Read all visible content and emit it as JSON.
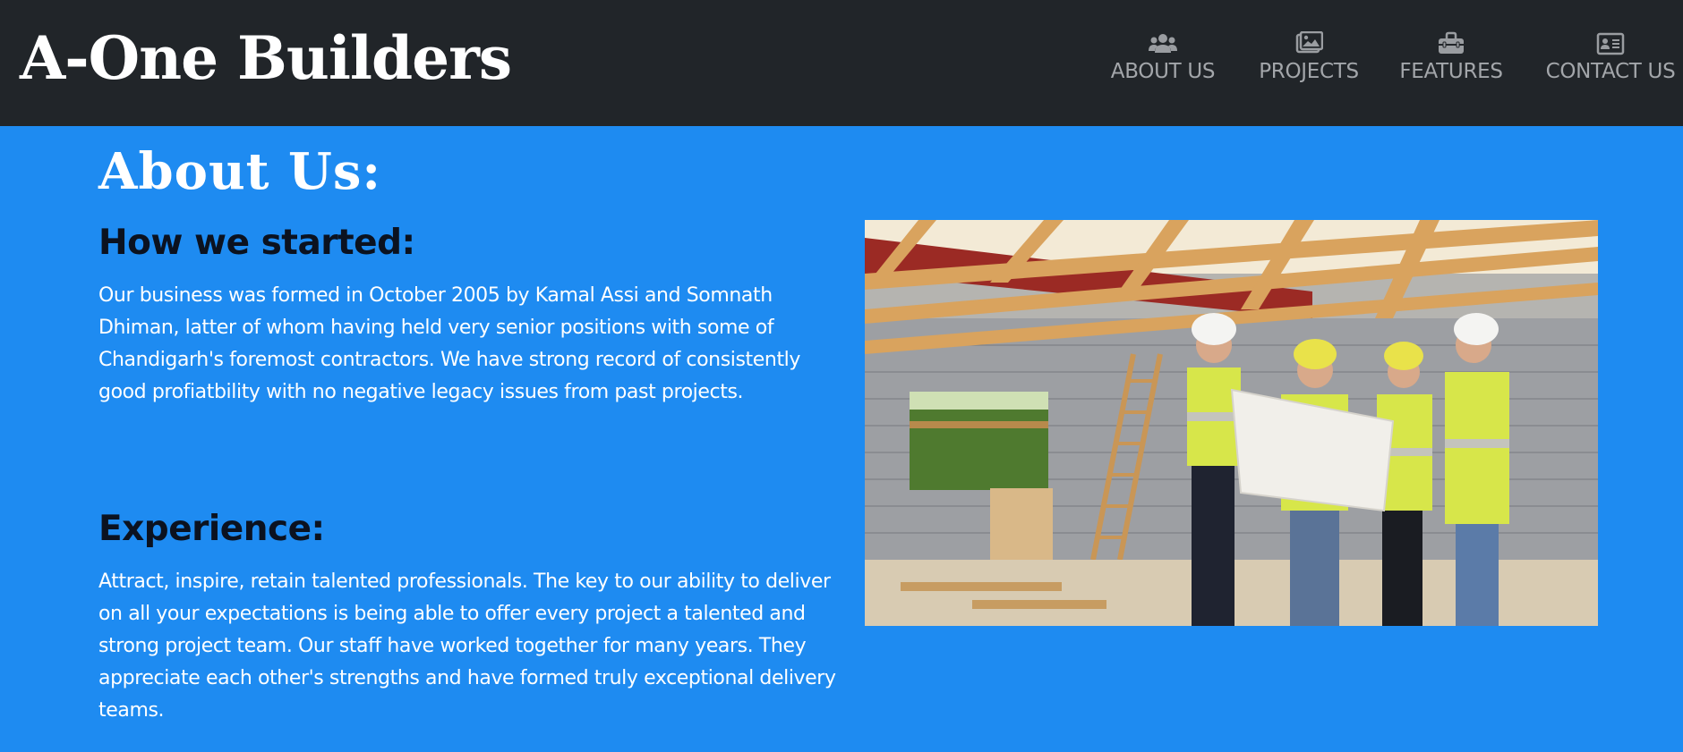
{
  "navbar": {
    "brand": "A-One Builders",
    "items": [
      {
        "label": "ABOUT US",
        "icon": "users-icon"
      },
      {
        "label": "PROJECTS",
        "icon": "images-icon"
      },
      {
        "label": "FEATURES",
        "icon": "toolbox-icon"
      },
      {
        "label": "CONTACT US",
        "icon": "address-card-icon"
      }
    ]
  },
  "main": {
    "title": "About Us:",
    "sections": [
      {
        "heading": "How we started:",
        "text": "Our business was formed in October 2005 by Kamal Assi and Somnath Dhiman, latter of whom having held very senior positions with some of Chandigarh's foremost contractors. We have strong record of consistently good profiatbility with no negative legacy issues from past projects."
      },
      {
        "heading": "Experience:",
        "text": "Attract, inspire, retain talented professionals. The key to our ability to deliver on all your expectations is being able to offer every project a talented and strong project team. Our staff have worked together for many years. They appreciate each other's strengths and have formed truly exceptional delivery teams."
      }
    ],
    "image": {
      "subject": "construction-workers-photo"
    }
  },
  "colors": {
    "navbar_bg": "#212529",
    "page_bg": "#1e8bf1",
    "nav_text": "#a3a6aa",
    "heading_text": "#0b1220",
    "body_text": "#ffffff"
  }
}
